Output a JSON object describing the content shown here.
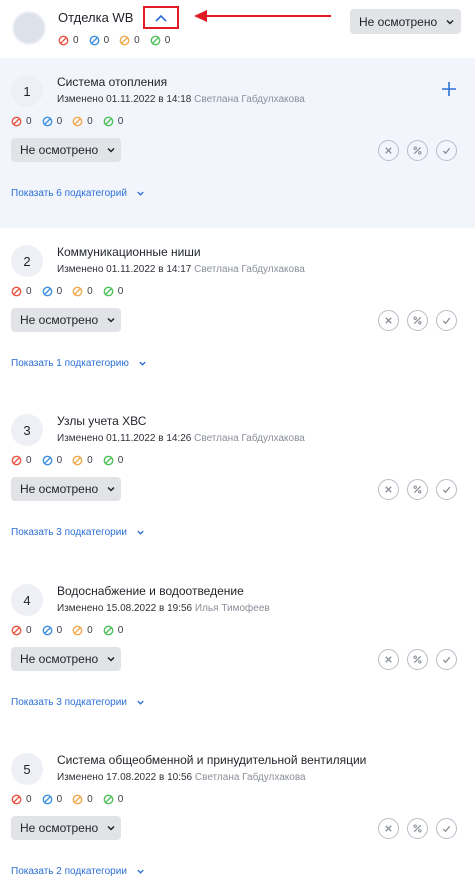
{
  "header": {
    "title": "Отделка WB",
    "status": "Не осмотрено",
    "counts": [
      "0",
      "0",
      "0",
      "0"
    ]
  },
  "sections": [
    {
      "number": "1",
      "title": "Система отопления",
      "changed_label": "Изменено",
      "date": "01.11.2022 в 14:18",
      "author": "Светлана Габдулхакова",
      "counts": [
        "0",
        "0",
        "0",
        "0"
      ],
      "status": "Не осмотрено",
      "subcategories": "Показать 6 подкатегорий",
      "active": true
    },
    {
      "number": "2",
      "title": "Коммуникационные ниши",
      "changed_label": "Изменено",
      "date": "01.11.2022 в 14:17",
      "author": "Светлана Габдулхакова",
      "counts": [
        "0",
        "0",
        "0",
        "0"
      ],
      "status": "Не осмотрено",
      "subcategories": "Показать 1 подкатегорию",
      "active": false
    },
    {
      "number": "3",
      "title": "Узлы учета ХВС",
      "changed_label": "Изменено",
      "date": "01.11.2022 в 14:26",
      "author": "Светлана Габдулхакова",
      "counts": [
        "0",
        "0",
        "0",
        "0"
      ],
      "status": "Не осмотрено",
      "subcategories": "Показать 3 подкатегории",
      "active": false
    },
    {
      "number": "4",
      "title": "Водоснабжение и водоотведение",
      "changed_label": "Изменено",
      "date": "15.08.2022 в 19:56",
      "author": "Илья Тимофеев",
      "counts": [
        "0",
        "0",
        "0",
        "0"
      ],
      "status": "Не осмотрено",
      "subcategories": "Показать 3 подкатегории",
      "active": false
    },
    {
      "number": "5",
      "title": "Система общеобменной и принудительной вентиляции",
      "changed_label": "Изменено",
      "date": "17.08.2022 в 10:56",
      "author": "Светлана Габдулхакова",
      "counts": [
        "0",
        "0",
        "0",
        "0"
      ],
      "status": "Не осмотрено",
      "subcategories": "Показать 2 подкатегории",
      "active": false
    }
  ],
  "colors": {
    "accent": "#2b6fd6",
    "highlight": "#e01b24",
    "counter_red": "#e8553f",
    "counter_blue": "#3d8fe0",
    "counter_orange": "#f0a84a",
    "counter_green": "#4fbf5a"
  },
  "icons": {
    "counters": [
      "red-ban-icon",
      "blue-ban-icon",
      "orange-ban-icon",
      "green-ban-icon"
    ],
    "actions": [
      "reject-icon",
      "percent-icon",
      "approve-icon"
    ]
  }
}
